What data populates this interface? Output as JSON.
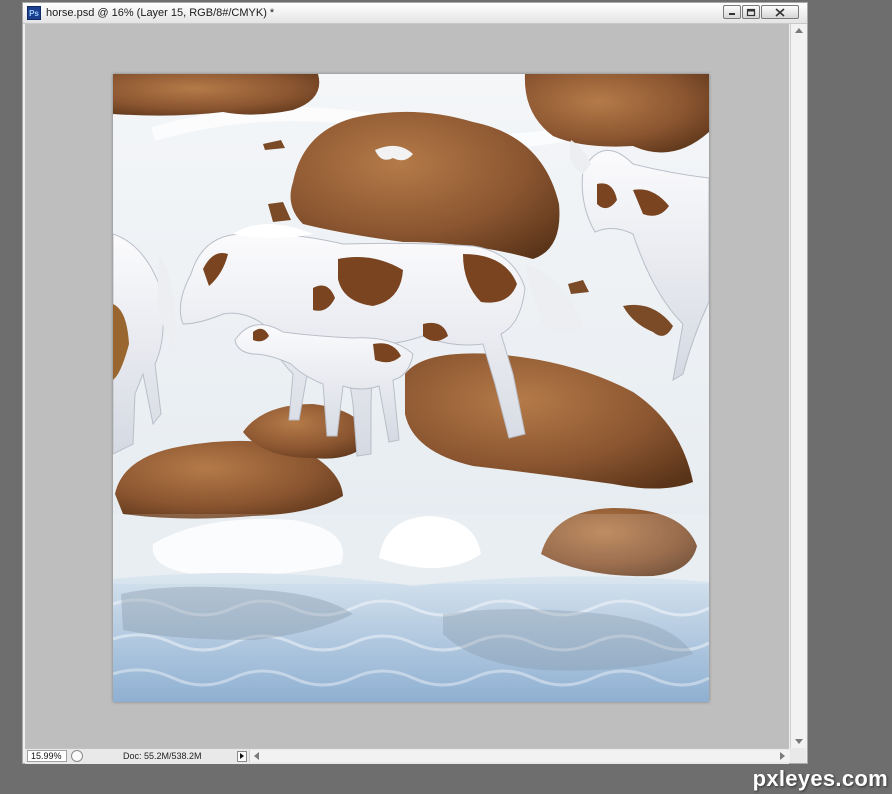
{
  "window": {
    "app_icon": "Ps",
    "title": "horse.psd @ 16% (Layer 15, RGB/8#/CMYK) *",
    "buttons": [
      "minimize-icon",
      "restore-icon",
      "close-icon"
    ]
  },
  "status": {
    "zoom": "15.99%",
    "doc_info": "Doc: 55.2M/538.2M"
  },
  "watermark": "pxleyes.com",
  "colors": {
    "canvas_bg": "#bebebe",
    "snow": "#eef1f4",
    "rock": "#8a5a34",
    "water": "#a9c4dc",
    "horse_white": "#f2f3f6",
    "horse_patch": "#7a4420"
  }
}
